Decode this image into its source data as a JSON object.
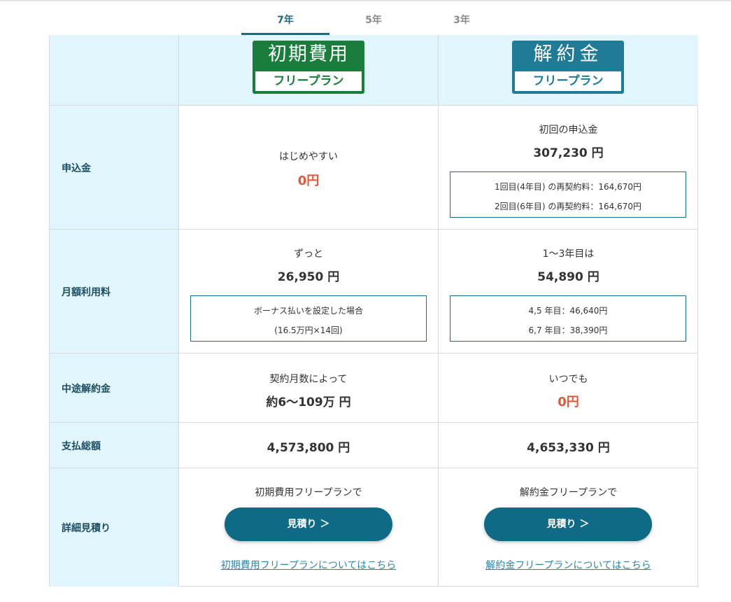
{
  "tabs": [
    {
      "label": "7年",
      "active": true
    },
    {
      "label": "5年",
      "active": false
    },
    {
      "label": "3年",
      "active": false
    }
  ],
  "plans": {
    "initial_free": {
      "badge_top": "初期費用",
      "badge_bottom": "フリープラン",
      "color": "#1a7d3c"
    },
    "cancel_free": {
      "badge_top": "解約金",
      "badge_bottom": "フリープラン",
      "color": "#1f7b96"
    }
  },
  "rows": {
    "application_fee": {
      "label": "申込金",
      "initial": {
        "caption": "はじめやすい",
        "value": "0円"
      },
      "cancel": {
        "caption": "初回の申込金",
        "value": "307,230 円",
        "notes": [
          "1回目(4年目) の再契約料：164,670円",
          "2回目(6年目) の再契約料：164,670円"
        ]
      }
    },
    "monthly_fee": {
      "label": "月額利用料",
      "initial": {
        "caption": "ずっと",
        "value": "26,950 円",
        "notes": [
          "ボーナス払いを設定した場合",
          "(16.5万円×14回)"
        ]
      },
      "cancel": {
        "caption": "1〜3年目は",
        "value": "54,890 円",
        "notes": [
          "4,5 年目：46,640円",
          "6,7 年目：38,390円"
        ]
      }
    },
    "cancellation_fee": {
      "label": "中途解約金",
      "initial": {
        "caption": "契約月数によって",
        "value": "約6〜109万 円"
      },
      "cancel": {
        "caption": "いつでも",
        "value": "0円"
      }
    },
    "total": {
      "label": "支払総額",
      "initial": {
        "value": "4,573,800 円"
      },
      "cancel": {
        "value": "4,653,330 円"
      }
    },
    "estimate": {
      "label": "詳細見積り",
      "initial": {
        "caption": "初期費用フリープランで",
        "button": "見積り ＞",
        "link": "初期費用フリープランについてはこちら"
      },
      "cancel": {
        "caption": "解約金フリープランで",
        "button": "見積り ＞",
        "link": "解約金フリープランについてはこちら"
      }
    }
  },
  "colors": {
    "accent": "#1b6a83",
    "label_bg": "#e1f5fc",
    "highlight_red": "#e05a3a",
    "button": "#0e6a85"
  }
}
